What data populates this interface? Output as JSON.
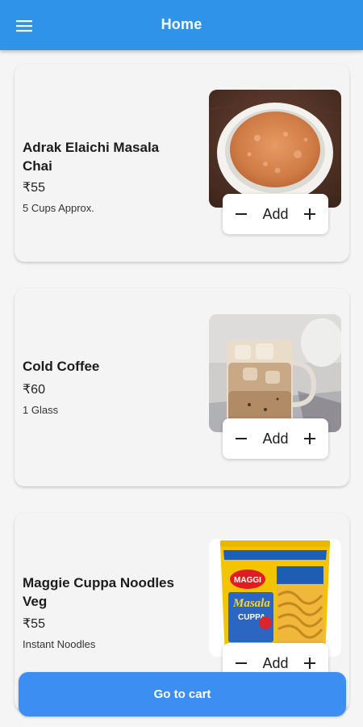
{
  "header": {
    "title": "Home",
    "menu_icon": "hamburger-menu-icon",
    "background_color": "#2f93e9"
  },
  "products": [
    {
      "name": "Adrak Elaichi Masala Chai",
      "price": "₹55",
      "quantity_note": "5 Cups Approx.",
      "image": "masala-chai-cup-image",
      "add_label": "Add"
    },
    {
      "name": "Cold Coffee",
      "price": "₹60",
      "quantity_note": "1 Glass",
      "image": "cold-coffee-glass-image",
      "add_label": "Add"
    },
    {
      "name": "Maggie Cuppa Noodles Veg",
      "price": "₹55",
      "quantity_note": "Instant Noodles",
      "image": "maggi-cuppa-noodles-image",
      "add_label": "Add",
      "image_text": {
        "brand": "MAGGI",
        "product": "Masala",
        "sub": "CUPPA"
      }
    }
  ],
  "footer": {
    "cart_button_label": "Go to cart",
    "button_color": "#3d8ef3"
  }
}
